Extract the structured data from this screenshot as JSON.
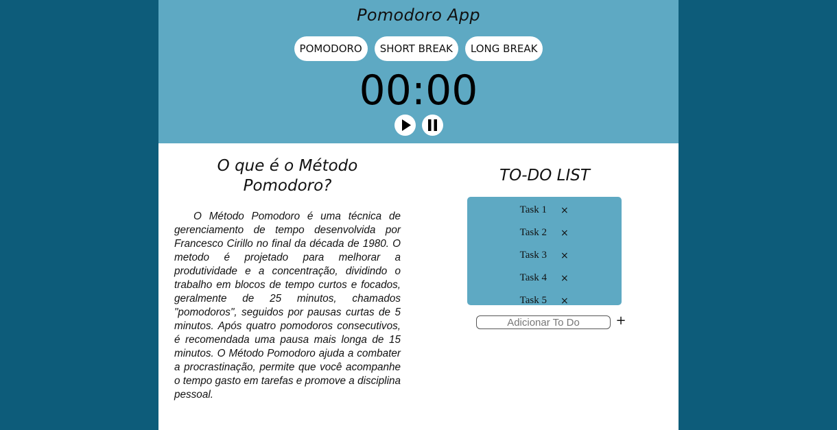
{
  "app": {
    "title": "Pomodoro App"
  },
  "modes": [
    {
      "label": "POMODORO"
    },
    {
      "label": "SHORT BREAK"
    },
    {
      "label": "LONG BREAK"
    }
  ],
  "timer": {
    "display": "00:00"
  },
  "controls": {
    "play_icon": "play-icon",
    "pause_icon": "pause-icon"
  },
  "info": {
    "title": "O que é o Método Pomodoro?",
    "text": "O Método Pomodoro é uma técnica de gerenciamento de tempo desenvolvida por Francesco Cirillo no final da década de 1980. O metodo é projetado para melhorar a produtividade e a concentração, dividindo o trabalho em blocos de tempo curtos e focados, geralmente de 25 minutos, chamados \"pomodoros\", seguidos por pausas curtas de 5 minutos. Após quatro pomodoros consecutivos, é recomendada uma pausa mais longa de 15 minutos. O Método Pomodoro ajuda a combater a procrastinação, permite que você acompanhe o tempo gasto em tarefas e promove a disciplina pessoal."
  },
  "todo": {
    "title": "TO-DO LIST",
    "items": [
      {
        "label": "Task 1",
        "remove": "×"
      },
      {
        "label": "Task 2",
        "remove": "×"
      },
      {
        "label": "Task 3",
        "remove": "×"
      },
      {
        "label": "Task 4",
        "remove": "×"
      },
      {
        "label": "Task 5",
        "remove": "×"
      }
    ],
    "input_placeholder": "Adicionar To Do",
    "input_value": "",
    "add_label": "+"
  },
  "colors": {
    "background": "#0d5c7a",
    "accent": "#5ea9c3",
    "surface": "#ffffff"
  }
}
